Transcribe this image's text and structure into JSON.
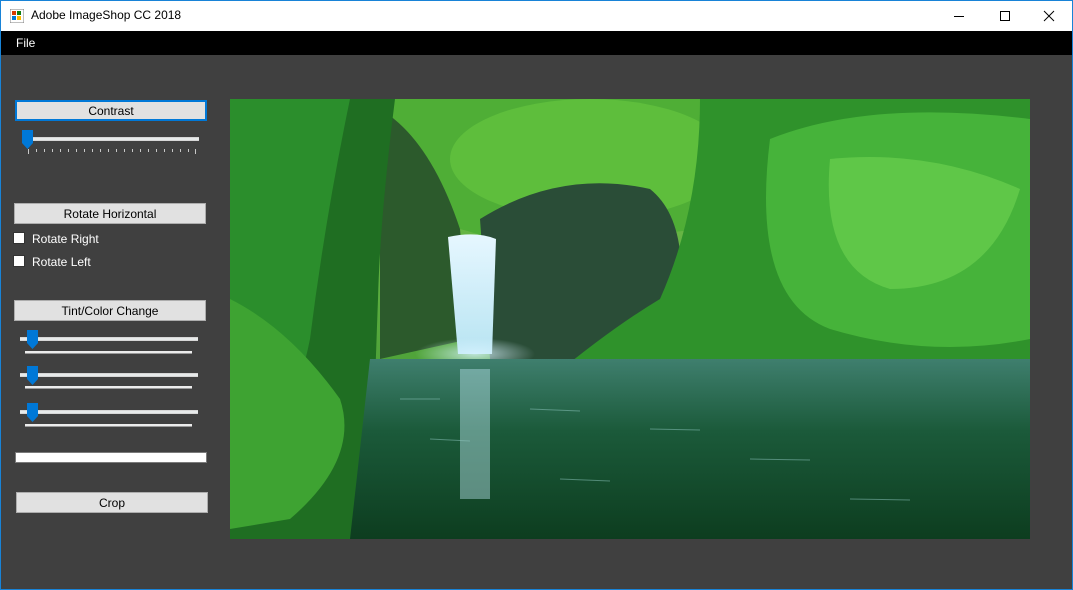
{
  "window": {
    "title": "Adobe ImageShop CC 2018"
  },
  "menu": {
    "file_label": "File"
  },
  "controls": {
    "contrast_button": "Contrast",
    "contrast_slider_value": 0,
    "rotate_horizontal_button": "Rotate Horizontal",
    "rotate_right_label": "Rotate Right",
    "rotate_right_checked": false,
    "rotate_left_label": "Rotate Left",
    "rotate_left_checked": false,
    "tint_button": "Tint/Color Change",
    "tint_slider_1_value": 0,
    "tint_slider_2_value": 0,
    "tint_slider_3_value": 0,
    "text_field_value": "",
    "crop_button": "Crop"
  },
  "picture": {
    "subject": "waterfall-in-green-canyon"
  },
  "colors": {
    "accent": "#0078d7",
    "background": "#404040",
    "menubar": "#000000",
    "window_border": "#1883d7"
  },
  "icons": [
    "app-icon",
    "minimize-icon",
    "maximize-icon",
    "close-icon"
  ]
}
